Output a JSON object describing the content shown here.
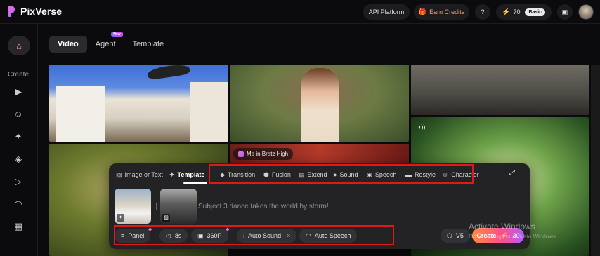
{
  "brand": {
    "name": "PixVerse"
  },
  "header": {
    "api_platform": "API Platform",
    "earn_credits": "Earn Credits",
    "credits": "70",
    "plan": "Basic"
  },
  "sidebar": {
    "create_label": "Create"
  },
  "tabs": [
    {
      "label": "Video",
      "active": true
    },
    {
      "label": "Agent",
      "badge": "New"
    },
    {
      "label": "Template"
    }
  ],
  "gallery": {
    "chip_label": "Me in Bratz High"
  },
  "panel": {
    "modes": [
      {
        "label": "Image or Text",
        "icon": "image-icon"
      },
      {
        "label": "Template",
        "icon": "sparkle-icon",
        "active": true
      },
      {
        "label": "Transition",
        "icon": "diamond-icon"
      },
      {
        "label": "Fusion",
        "icon": "cube-icon"
      },
      {
        "label": "Extend",
        "icon": "extend-icon"
      },
      {
        "label": "Sound",
        "icon": "sound-icon"
      },
      {
        "label": "Speech",
        "icon": "eye-icon"
      },
      {
        "label": "Restyle",
        "icon": "brush-icon"
      },
      {
        "label": "Character",
        "icon": "face-icon"
      }
    ],
    "prompt_placeholder": "Subject 3 dance takes the world by storm!",
    "controls": {
      "panel": "Panel",
      "duration": "8s",
      "resolution": "360P",
      "auto_sound": "Auto Sound",
      "auto_speech": "Auto Speech",
      "model": "V5"
    },
    "create": {
      "label": "Create",
      "cost": "30"
    }
  },
  "watermark": {
    "line1": "Activate Windows",
    "line2": "Go to Settings to activate Windows."
  },
  "colors": {
    "accent": "#ff4f8b",
    "highlight_box": "#e01818",
    "credits_bolt": "#ffcf2e"
  }
}
